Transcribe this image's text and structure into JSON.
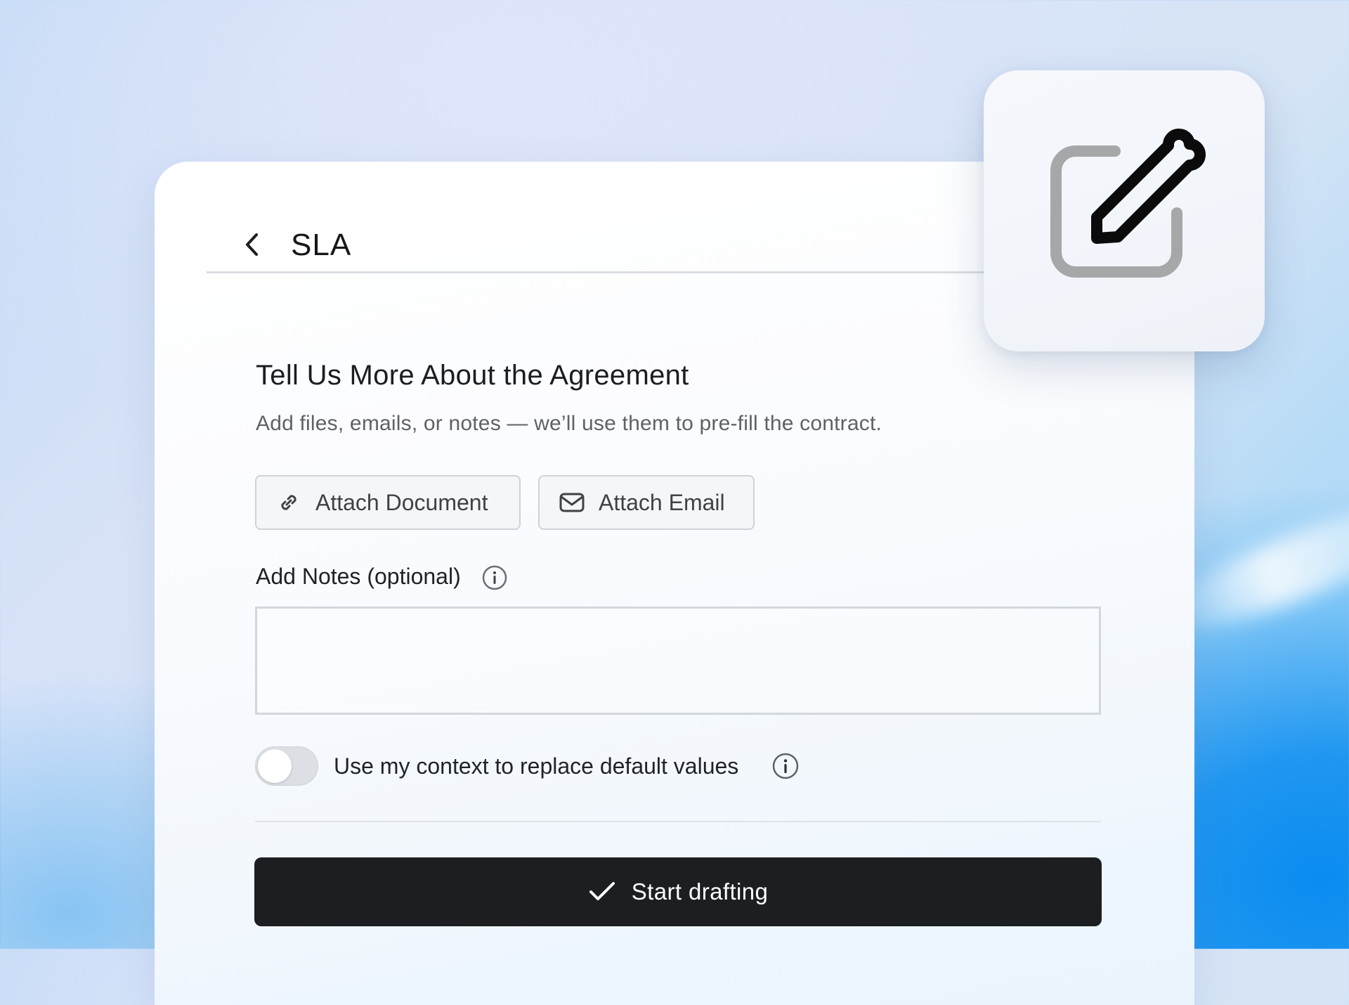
{
  "header": {
    "title": "SLA",
    "back_icon": "chevron-left-icon",
    "search_icon": "search-icon"
  },
  "form": {
    "title": "Tell Us More About the Agreement",
    "subtitle": "Add files, emails, or notes — we’ll use them to pre-fill the contract.",
    "attach_document_label": "Attach Document",
    "attach_email_label": "Attach Email",
    "notes_label": "Add Notes (optional)",
    "notes_value": "",
    "toggle_label": "Use my context to replace default values",
    "toggle_on": false,
    "submit_label": "Start drafting"
  },
  "floating_tile": {
    "icon": "edit-icon"
  },
  "colors": {
    "primary_button": "#1c1e22",
    "card_background": "#ffffff",
    "border": "#cfd3d9",
    "muted_text": "#5e6268"
  }
}
